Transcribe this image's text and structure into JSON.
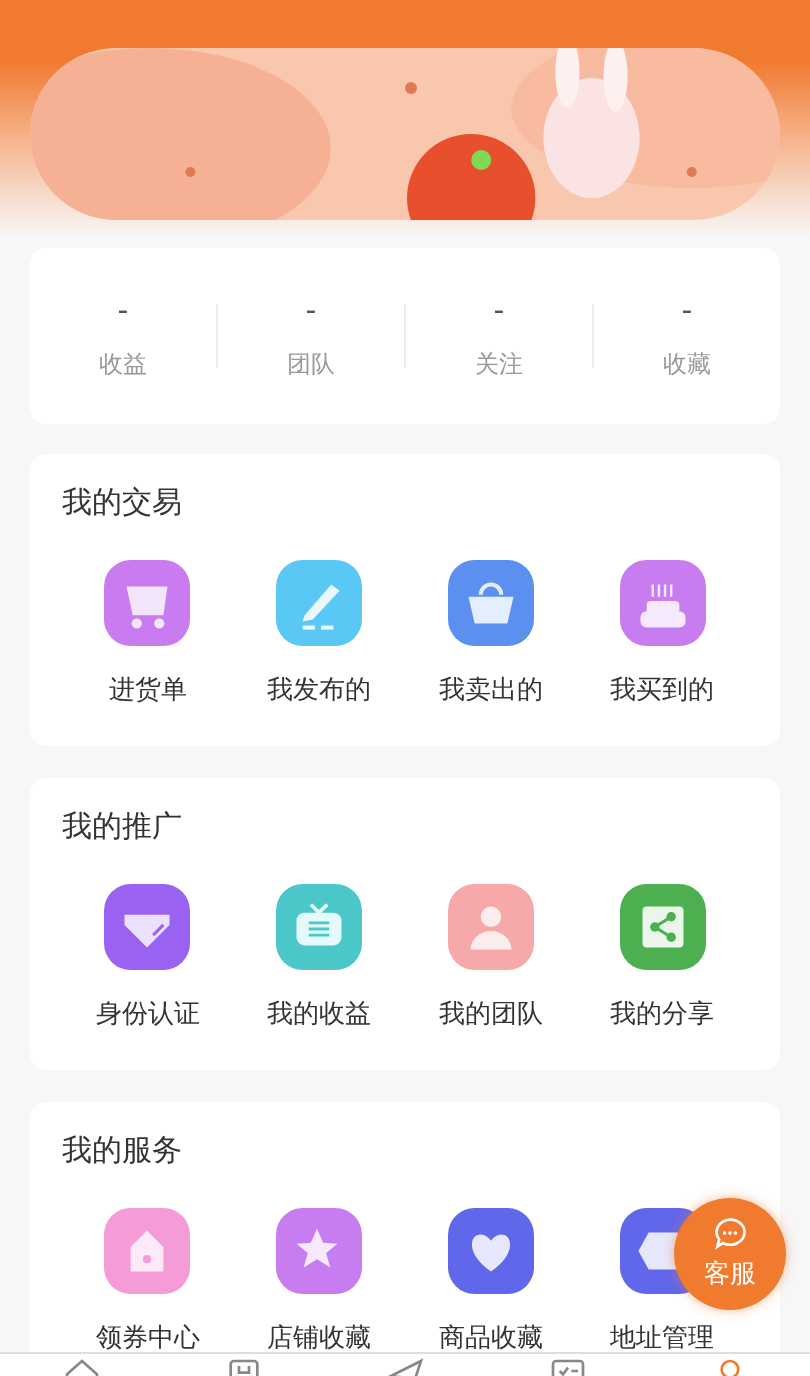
{
  "stats": [
    {
      "value": "-",
      "label": "收益"
    },
    {
      "value": "-",
      "label": "团队"
    },
    {
      "value": "-",
      "label": "关注"
    },
    {
      "value": "-",
      "label": "收藏"
    }
  ],
  "sections": [
    {
      "title": "我的交易",
      "items": [
        {
          "label": "进货单",
          "color": "#c97cf0"
        },
        {
          "label": "我发布的",
          "color": "#5ac8f5"
        },
        {
          "label": "我卖出的",
          "color": "#5b8ff0"
        },
        {
          "label": "我买到的",
          "color": "#c77cf0"
        }
      ]
    },
    {
      "title": "我的推广",
      "items": [
        {
          "label": "身份认证",
          "color": "#9a62f0"
        },
        {
          "label": "我的收益",
          "color": "#4cc7c9"
        },
        {
          "label": "我的团队",
          "color": "#f6a9a8"
        },
        {
          "label": "我的分享",
          "color": "#4caf50"
        }
      ]
    },
    {
      "title": "我的服务",
      "items": [
        {
          "label": "领券中心",
          "color": "#f49bd8"
        },
        {
          "label": "店铺收藏",
          "color": "#c77cf0"
        },
        {
          "label": "商品收藏",
          "color": "#6167ea"
        },
        {
          "label": "地址管理",
          "color": "#6167ea"
        }
      ]
    }
  ],
  "service_button": {
    "label": "客服"
  },
  "tabs": [
    {
      "selected": false
    },
    {
      "selected": false
    },
    {
      "selected": false
    },
    {
      "selected": false
    },
    {
      "selected": true
    }
  ]
}
